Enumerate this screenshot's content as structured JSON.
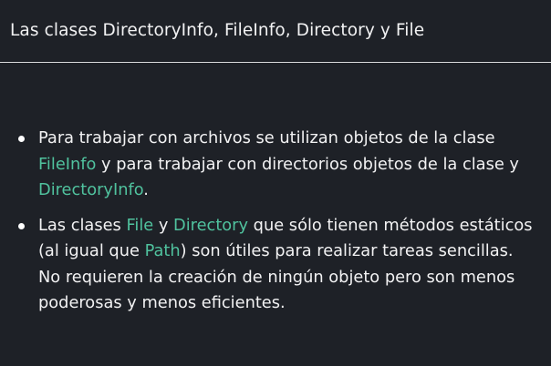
{
  "header": {
    "title": "Las clases DirectoryInfo, FileInfo, Directory y File"
  },
  "bullets": [
    {
      "parts": [
        {
          "text": "Para trabajar con archivos se utilizan objetos de la clase ",
          "kw": false
        },
        {
          "text": "FileInfo",
          "kw": true
        },
        {
          "text": " y para trabajar con directorios objetos de la clase y ",
          "kw": false
        },
        {
          "text": "DirectoryInfo",
          "kw": true
        },
        {
          "text": ".",
          "kw": false
        }
      ]
    },
    {
      "parts": [
        {
          "text": "Las clases ",
          "kw": false
        },
        {
          "text": "File",
          "kw": true
        },
        {
          "text": " y ",
          "kw": false
        },
        {
          "text": "Directory",
          "kw": true
        },
        {
          "text": " que sólo tienen métodos estáticos (al igual que ",
          "kw": false
        },
        {
          "text": "Path",
          "kw": true
        },
        {
          "text": ") son útiles para realizar tareas sencillas. No requieren la creación de ningún objeto pero son menos poderosas y menos eficientes.",
          "kw": false
        }
      ]
    }
  ],
  "colors": {
    "background": "#1e2127",
    "text": "#f2f2f3",
    "keyword": "#50c29e",
    "divider": "#d9dadc"
  }
}
